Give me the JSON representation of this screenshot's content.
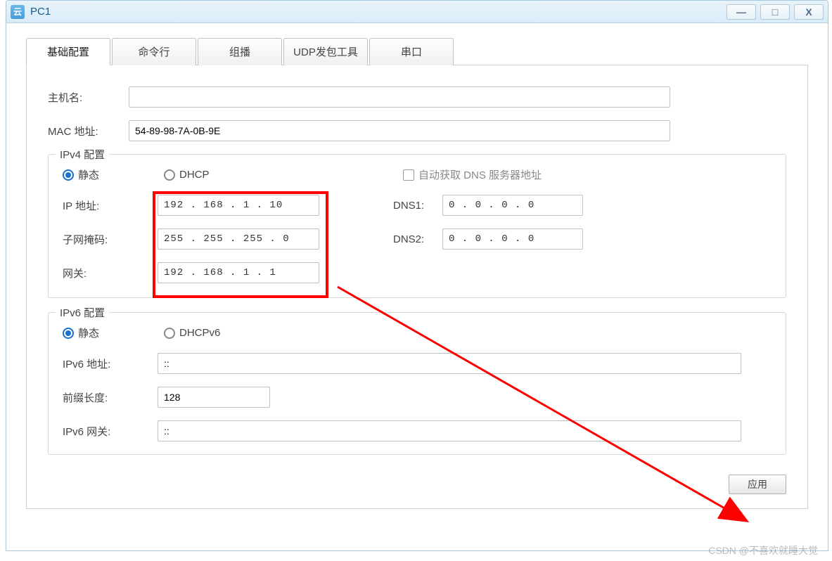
{
  "window": {
    "title": "PC1"
  },
  "tabs": [
    {
      "label": "基础配置",
      "active": true
    },
    {
      "label": "命令行",
      "active": false
    },
    {
      "label": "组播",
      "active": false
    },
    {
      "label": "UDP发包工具",
      "active": false
    },
    {
      "label": "串口",
      "active": false
    }
  ],
  "basic": {
    "hostname_label": "主机名:",
    "hostname_value": "",
    "mac_label": "MAC 地址:",
    "mac_value": "54-89-98-7A-0B-9E"
  },
  "ipv4": {
    "legend": "IPv4 配置",
    "static_label": "静态",
    "dhcp_label": "DHCP",
    "auto_dns_label": "自动获取 DNS 服务器地址",
    "ip_label": "IP 地址:",
    "ip_value": "192  .  168  .   1    .   10",
    "mask_label": "子网掩码:",
    "mask_value": "255  .  255  .  255  .   0",
    "gw_label": "网关:",
    "gw_value": "192  .  168  .   1    .   1",
    "dns1_label": "DNS1:",
    "dns1_value": "0    .   0    .   0    .   0",
    "dns2_label": "DNS2:",
    "dns2_value": "0    .   0    .   0    .   0"
  },
  "ipv6": {
    "legend": "IPv6 配置",
    "static_label": "静态",
    "dhcpv6_label": "DHCPv6",
    "addr_label": "IPv6 地址:",
    "addr_value": "::",
    "prefix_label": "前缀长度:",
    "prefix_value": "128",
    "gw_label": "IPv6 网关:",
    "gw_value": "::"
  },
  "buttons": {
    "apply": "应用"
  },
  "watermark": "CSDN @不喜欢就睡大觉",
  "annotation": {
    "highlight_color": "#ff0000",
    "arrow_color": "#ff0000"
  }
}
